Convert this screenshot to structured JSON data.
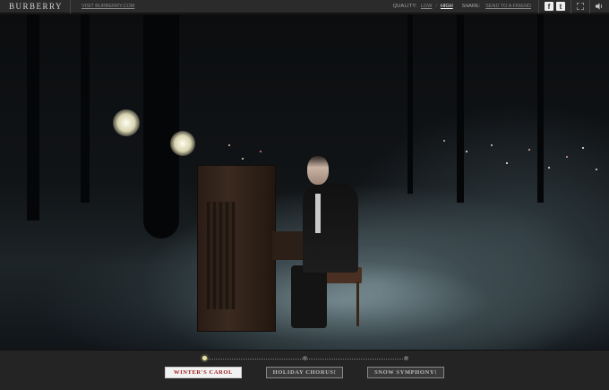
{
  "header": {
    "logo": "BURBERRY",
    "visit_link": "VISIT BURBERRY.COM",
    "quality": {
      "label": "QUALITY:",
      "options": [
        "LOW",
        "HIGH"
      ],
      "selected": "HIGH"
    },
    "share": {
      "label": "SHARE:",
      "link": "SEND TO A FRIEND"
    },
    "icons": {
      "facebook": "f",
      "twitter": "t",
      "fullscreen": "⤢",
      "sound": "🔈"
    }
  },
  "player": {
    "progress": 0.0,
    "chapters": [
      {
        "label": "WINTER'S CAROL",
        "active": true
      },
      {
        "label": "HOLIDAY CHORUS!",
        "active": false
      },
      {
        "label": "SNOW SYMPHONY!",
        "active": false
      }
    ]
  },
  "colors": {
    "active_chapter_text": "#9b1a1a",
    "active_dot": "#e8e2a0",
    "bar_background": "#242424"
  }
}
